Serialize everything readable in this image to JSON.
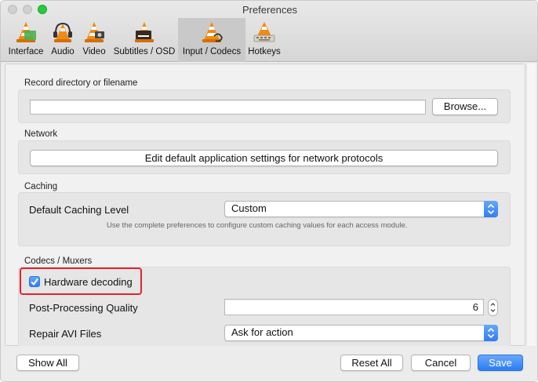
{
  "window": {
    "title": "Preferences"
  },
  "tabs": [
    {
      "label": "Interface",
      "icon": "interface-cone-icon"
    },
    {
      "label": "Audio",
      "icon": "audio-cone-headphones-icon"
    },
    {
      "label": "Video",
      "icon": "video-cone-icon"
    },
    {
      "label": "Subtitles / OSD",
      "icon": "subtitles-cone-icon"
    },
    {
      "label": "Input / Codecs",
      "icon": "input-codecs-cone-icon",
      "active": true
    },
    {
      "label": "Hotkeys",
      "icon": "hotkeys-cone-icon"
    }
  ],
  "record": {
    "section_title": "Record directory or filename",
    "path_value": "",
    "browse_label": "Browse..."
  },
  "network": {
    "section_title": "Network",
    "edit_button_label": "Edit default application settings for network protocols"
  },
  "caching": {
    "section_title": "Caching",
    "level_label": "Default Caching Level",
    "level_value": "Custom",
    "hint": "Use the complete preferences to configure custom caching values for each access module."
  },
  "codecs": {
    "section_title": "Codecs / Muxers",
    "hw_decoding_label": "Hardware decoding",
    "hw_decoding_checked": true,
    "pp_label": "Post-Processing Quality",
    "pp_value": "6",
    "avi_label": "Repair AVI Files",
    "avi_value": "Ask for action"
  },
  "footer": {
    "show_all_label": "Show All",
    "reset_all_label": "Reset All",
    "cancel_label": "Cancel",
    "save_label": "Save"
  },
  "colors": {
    "accent": "#2f7ff2",
    "highlight": "#e0252b",
    "cone_orange": "#f08a13"
  }
}
